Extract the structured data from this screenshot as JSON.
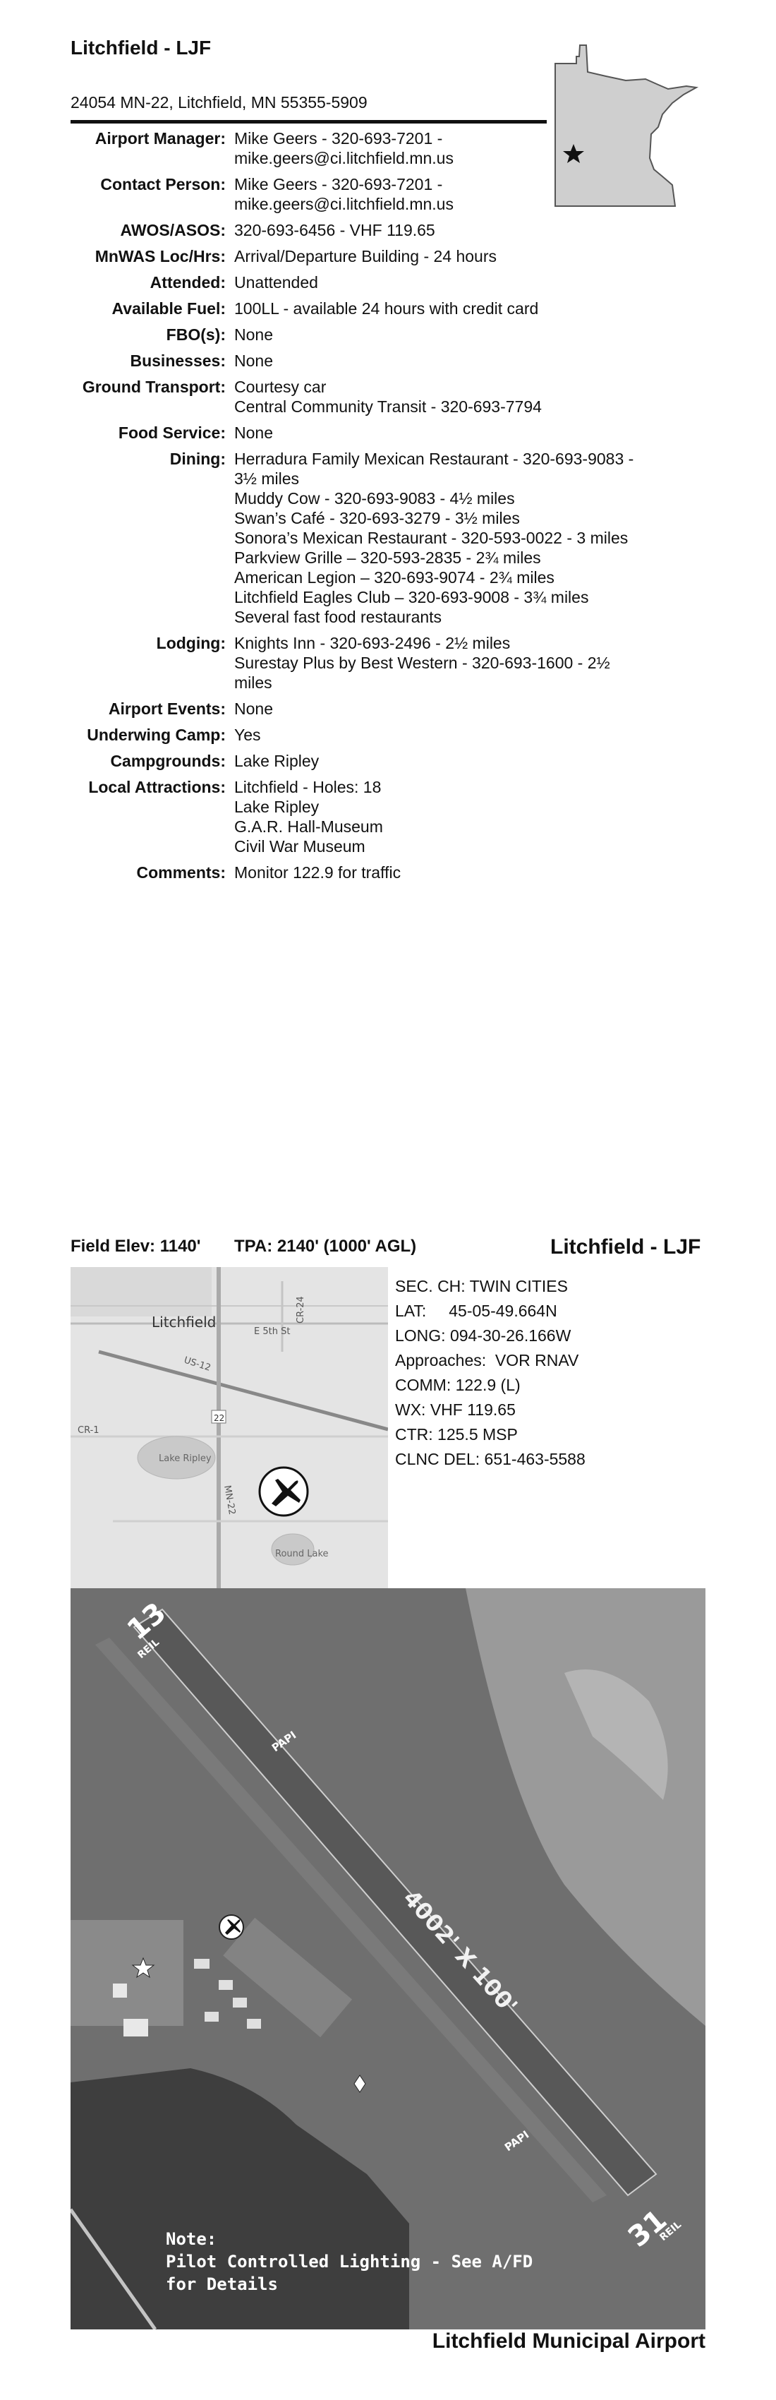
{
  "header": {
    "title": "Litchfield - LJF",
    "address": "24054 MN-22, Litchfield, MN 55355-5909"
  },
  "info_rows": [
    {
      "label": "Airport Manager:",
      "lines": [
        "Mike Geers - 320-693-7201 -",
        "mike.geers@ci.litchfield.mn.us"
      ]
    },
    {
      "label": "Contact Person:",
      "lines": [
        "Mike Geers - 320-693-7201 -",
        "mike.geers@ci.litchfield.mn.us"
      ]
    },
    {
      "label": "AWOS/ASOS:",
      "lines": [
        "320-693-6456 - VHF 119.65"
      ]
    },
    {
      "label": "MnWAS Loc/Hrs:",
      "lines": [
        "Arrival/Departure Building - 24 hours"
      ]
    },
    {
      "label": "Attended:",
      "lines": [
        "Unattended"
      ]
    },
    {
      "label": "Available Fuel:",
      "lines": [
        "100LL - available 24 hours with credit card"
      ]
    },
    {
      "label": "FBO(s):",
      "lines": [
        "None"
      ]
    },
    {
      "label": "Businesses:",
      "lines": [
        "None"
      ]
    },
    {
      "label": "Ground Transport:",
      "lines": [
        "Courtesy car",
        "Central Community Transit - 320-693-7794"
      ]
    },
    {
      "label": "Food Service:",
      "lines": [
        "None"
      ]
    },
    {
      "label": "Dining:",
      "lines": [
        "Herradura Family Mexican Restaurant - 320-693-9083 -",
        "3½ miles",
        "Muddy Cow - 320-693-9083 - 4½ miles",
        "Swan’s Café - 320-693-3279 - 3½ miles",
        "Sonora’s Mexican Restaurant - 320-593-0022 - 3 miles",
        "Parkview Grille – 320-593-2835 - 2¾ miles",
        "American Legion – 320-693-9074 - 2¾ miles",
        "Litchfield Eagles Club – 320-693-9008 - 3¾ miles",
        "Several fast food restaurants"
      ]
    },
    {
      "label": "Lodging:",
      "lines": [
        "Knights Inn - 320-693-2496 - 2½ miles",
        "Surestay Plus by Best Western - 320-693-1600 - 2½",
        "miles"
      ]
    },
    {
      "label": "Airport Events:",
      "lines": [
        "None"
      ]
    },
    {
      "label": "Underwing Camp:",
      "lines": [
        "Yes"
      ]
    },
    {
      "label": "Campgrounds:",
      "lines": [
        "Lake Ripley"
      ]
    },
    {
      "label": "Local Attractions:",
      "lines": [
        "Litchfield - Holes: 18",
        "Lake Ripley",
        "G.A.R. Hall-Museum",
        "Civil War Museum"
      ]
    },
    {
      "label": "Comments:",
      "lines": [
        "Monitor 122.9 for traffic"
      ]
    }
  ],
  "page2": {
    "field_elev": "Field Elev: 1140'",
    "tpa": "TPA: 2140' (1000' AGL)",
    "title": "Litchfield - LJF",
    "details": [
      "SEC. CH: TWIN CITIES",
      "LAT:     45-05-49.664N",
      "LONG: 094-30-26.166W",
      "Approaches:  VOR RNAV",
      "COMM: 122.9 (L)",
      "WX: VHF 119.65",
      "CTR: 125.5 MSP",
      "CLNC DEL: 651-463-5588"
    ]
  },
  "location_map": {
    "town_label": "Litchfield",
    "road_labels": [
      "E 5th St",
      "CR-24",
      "US-12",
      "CR-1",
      "MN-22",
      "22"
    ],
    "lake_labels": [
      "Lake Ripley",
      "Round Lake"
    ]
  },
  "aerial": {
    "runway_dims": "4002' X 100'",
    "rwy13": "13",
    "rwy31": "31",
    "reil": "REIL",
    "papi": "PAPI",
    "note_title": "Note:",
    "note_line1": "Pilot Controlled Lighting - See A/FD",
    "note_line2": "for Details"
  },
  "footer": {
    "airport_name": "Litchfield Municipal Airport"
  }
}
